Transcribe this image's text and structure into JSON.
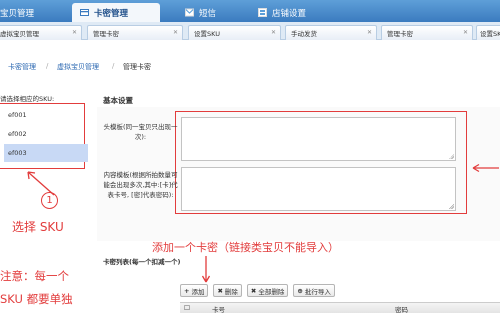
{
  "top_tabs": [
    {
      "label": "宝贝管理",
      "active": false
    },
    {
      "label": "卡密管理",
      "active": true
    },
    {
      "label": "短信",
      "active": false
    },
    {
      "label": "店铺设置",
      "active": false
    }
  ],
  "sub_tabs": [
    {
      "label": "虚拟宝贝管理"
    },
    {
      "label": "管理卡密"
    },
    {
      "label": "设置SKU"
    },
    {
      "label": "手动发货"
    },
    {
      "label": "管理卡密"
    },
    {
      "label": "设置SK"
    }
  ],
  "breadcrumb": {
    "items": [
      "卡密管理",
      "虚拟宝贝管理",
      "管理卡密"
    ],
    "separator": "/"
  },
  "sku_panel": {
    "title": "请选择相应的SKU:",
    "items": [
      {
        "label": "ef001",
        "selected": false
      },
      {
        "label": "ef002",
        "selected": false
      },
      {
        "label": "ef003",
        "selected": true
      }
    ]
  },
  "form": {
    "section_title": "基本设置",
    "header_template_label": "头模板(同一宝贝只出现一次):",
    "content_template_label": "内容模板(根据所拍数量可能会出现多次,其中:[卡]代表卡号, [密]代表密码):",
    "header_template_value": "",
    "content_template_value": ""
  },
  "annotations": {
    "step_number": "1",
    "select_sku": "选择 SKU",
    "add_card": "添加一个卡密（链接类宝贝不能导入）",
    "note_line1": "注意：每一个",
    "note_line2": "SKU 都要单独"
  },
  "card_list": {
    "title": "卡密列表(每一个扣减一个)"
  },
  "toolbar": {
    "add": "添加",
    "delete": "删除",
    "delete_all": "全部删除",
    "batch_import": "批行导入"
  },
  "grid": {
    "columns": [
      "卡号",
      "密码"
    ]
  },
  "colors": {
    "accent": "#3b7bbf",
    "annotation": "#e23c3c",
    "selected": "#c8d9f5"
  }
}
